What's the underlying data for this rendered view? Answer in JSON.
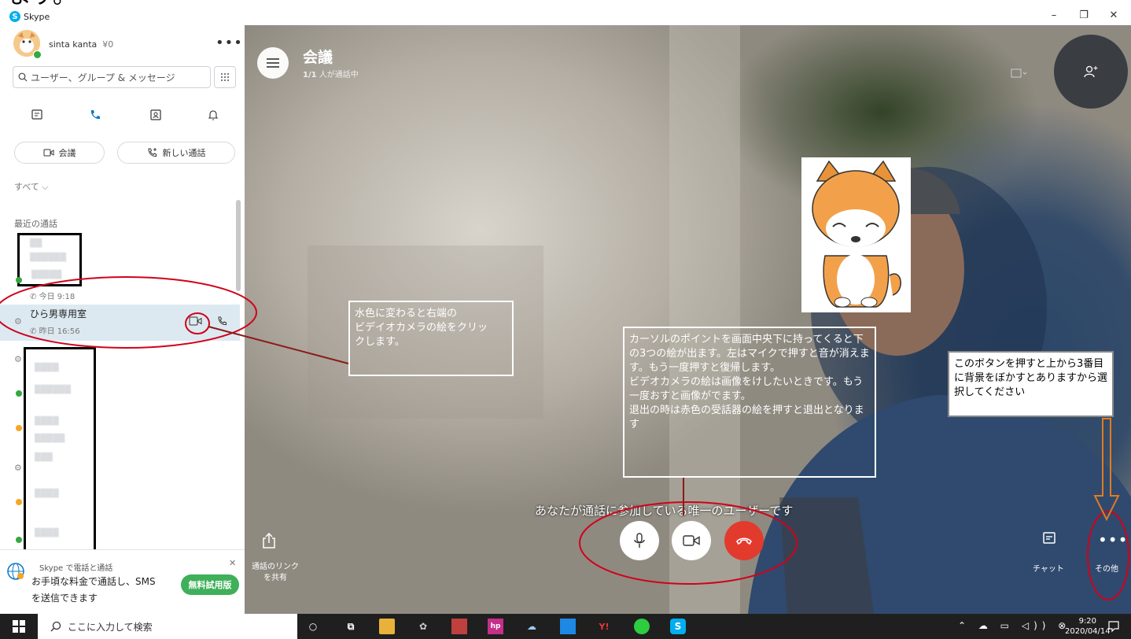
{
  "top_caption": "ます。",
  "window": {
    "title": "Skype",
    "minimize": "–",
    "maximize": "❐",
    "close": "✕"
  },
  "profile": {
    "name": "sinta kanta",
    "credit": "¥0",
    "more": "•••"
  },
  "search": {
    "placeholder": "ユーザー、グループ & メッセージ"
  },
  "actions": {
    "meeting": "会議",
    "new_call": "新しい通話"
  },
  "filter": "すべて ⌵",
  "recent": {
    "title": "最近の通話",
    "rows": [
      {
        "time": "今日 9:18"
      },
      {
        "name": "ひら男専用室",
        "time": "昨日 16:56"
      }
    ]
  },
  "promo": {
    "line1": "Skype で電話と通話",
    "line2": "お手頃な料金で通話し、SMS",
    "line3": "を送信できます",
    "button": "無料試用版",
    "close": "✕"
  },
  "call": {
    "title": "会議",
    "participants_count": "1/1",
    "participants_label": " 人が通話中",
    "message": "あなたが通話に参加している唯一のユーザーです",
    "share_label": "通話のリンクを共有",
    "chat_label": "チャット",
    "other_label": "その他"
  },
  "notes": {
    "note1": "水色に変わると右端の\nビデイオカメラの絵をクリッ\nクします。",
    "note2": "カーソルのポイントを画面中央下に持ってくると下の3つの絵が出ます。左はマイクで押すと音が消えます。もう一度押すと復帰します。\nビデオカメラの絵は画像をけしたいときです。もう一度おすと画像がでます。\n退出の時は赤色の受話器の絵を押すと退出となります",
    "note3": "このボタンを押すと上から3番目に背景をぼかすとありますから選択してください"
  },
  "taskbar": {
    "search_placeholder": "ここに入力して検索",
    "time": "9:20",
    "date": "2020/04/14"
  },
  "colors": {
    "skype_blue": "#00aff0",
    "hangup_red": "#e23b2e",
    "selected_row": "#dde9f1",
    "annotation_red": "#d0021b",
    "arrow_orange": "#e07b20",
    "trial_green": "#3faf5a"
  }
}
